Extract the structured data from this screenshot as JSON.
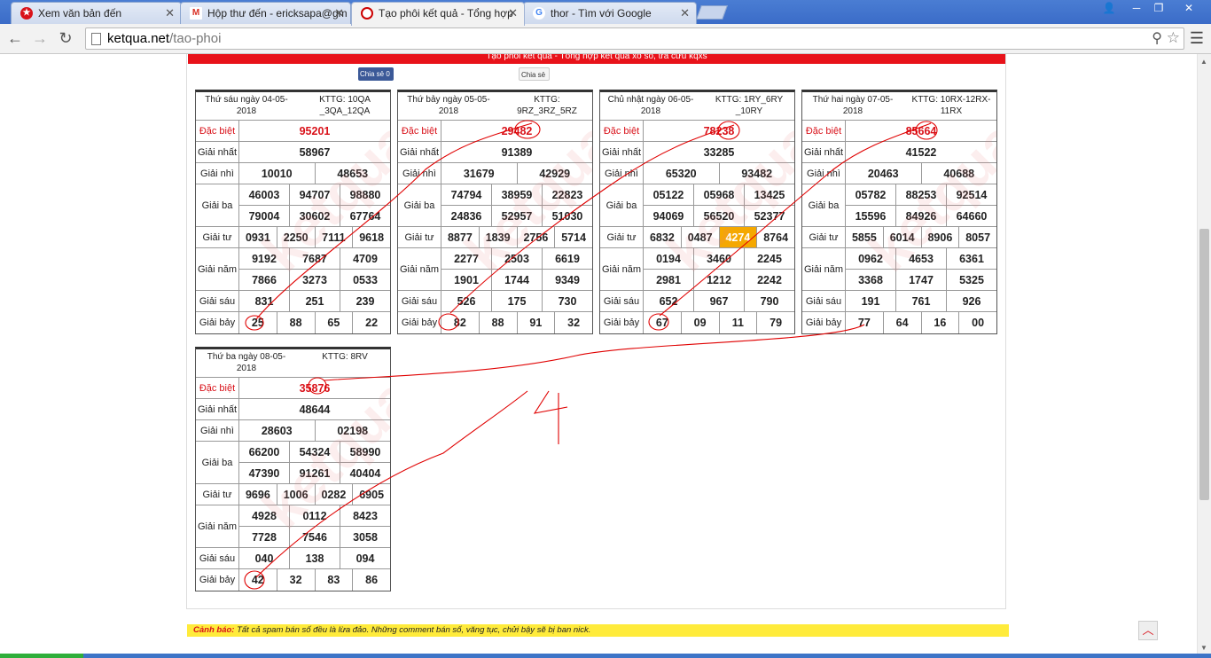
{
  "browser": {
    "tabs": [
      {
        "title": "Xem văn bản đến",
        "favicon": "star-seal-icon",
        "active": false
      },
      {
        "title": "Hộp thư đến - ericksapa@gm",
        "favicon": "gmail-icon",
        "active": false
      },
      {
        "title": "Tạo phôi kết quả - Tổng hợp",
        "favicon": "ketqua-icon",
        "active": true
      },
      {
        "title": "thor - Tìm với Google",
        "favicon": "google-icon",
        "active": false
      }
    ],
    "url_host": "ketqua.net",
    "url_path": "/tao-phoi"
  },
  "page": {
    "banner_text": "Tạo phôi kết quả - Tổng hợp kết quả xổ số, tra cứu kqxs",
    "share_fb": "Chia sẻ 0",
    "share_gplus": "Chia sẻ",
    "watermark": "ketqua.net",
    "warning_label": "Cảnh báo:",
    "warning_text": " Tất cả spam bán số đều là lừa đảo. Những comment bán số, văng tục, chửi bậy sẽ bị ban nick.",
    "annotation_number": "4",
    "colors": {
      "red": "#e8121a",
      "highlight": "#f5a800",
      "ink": "#e00000"
    }
  },
  "labels": {
    "db": "Đặc biệt",
    "g1": "Giải nhất",
    "g2": "Giải nhì",
    "g3": "Giải ba",
    "g4": "Giải tư",
    "g5": "Giải năm",
    "g6": "Giải sáu",
    "g7": "Giải bảy"
  },
  "results": [
    {
      "date": "Thứ sáu ngày 04-05-2018",
      "kttg": "KTTG: 10QA _3QA_12QA",
      "db": "95201",
      "g1": "58967",
      "g2": [
        "10010",
        "48653"
      ],
      "g3": [
        [
          "46003",
          "94707",
          "98880"
        ],
        [
          "79004",
          "30602",
          "67764"
        ]
      ],
      "g4": [
        "0931",
        "2250",
        "7111",
        "9618"
      ],
      "g5": [
        [
          "9192",
          "7687",
          "4709"
        ],
        [
          "7866",
          "3273",
          "0533"
        ]
      ],
      "g6": [
        "831",
        "251",
        "239"
      ],
      "g7": [
        "25",
        "88",
        "65",
        "22"
      ],
      "hl": -1
    },
    {
      "date": "Thứ bảy ngày 05-05-2018",
      "kttg": "KTTG: 9RZ_3RZ_5RZ",
      "db": "29482",
      "g1": "91389",
      "g2": [
        "31679",
        "42929"
      ],
      "g3": [
        [
          "74794",
          "38959",
          "22823"
        ],
        [
          "24836",
          "52957",
          "51030"
        ]
      ],
      "g4": [
        "8877",
        "1839",
        "2756",
        "5714"
      ],
      "g5": [
        [
          "2277",
          "2503",
          "6619"
        ],
        [
          "1901",
          "1744",
          "9349"
        ]
      ],
      "g6": [
        "526",
        "175",
        "730"
      ],
      "g7": [
        "82",
        "88",
        "91",
        "32"
      ],
      "hl": -1
    },
    {
      "date": "Chủ nhật ngày 06-05-2018",
      "kttg": "KTTG: 1RY_6RY _10RY",
      "db": "78238",
      "g1": "33285",
      "g2": [
        "65320",
        "93482"
      ],
      "g3": [
        [
          "05122",
          "05968",
          "13425"
        ],
        [
          "94069",
          "56520",
          "52377"
        ]
      ],
      "g4": [
        "6832",
        "0487",
        "4274",
        "8764"
      ],
      "g5": [
        [
          "0194",
          "3460",
          "2245"
        ],
        [
          "2981",
          "1212",
          "2242"
        ]
      ],
      "g6": [
        "652",
        "967",
        "790"
      ],
      "g7": [
        "67",
        "09",
        "11",
        "79"
      ],
      "hl": 2
    },
    {
      "date": "Thứ hai ngày 07-05-2018",
      "kttg": "KTTG: 10RX-12RX-11RX",
      "db": "85664",
      "g1": "41522",
      "g2": [
        "20463",
        "40688"
      ],
      "g3": [
        [
          "05782",
          "88253",
          "92514"
        ],
        [
          "15596",
          "84926",
          "64660"
        ]
      ],
      "g4": [
        "5855",
        "6014",
        "8906",
        "8057"
      ],
      "g5": [
        [
          "0962",
          "4653",
          "6361"
        ],
        [
          "3368",
          "1747",
          "5325"
        ]
      ],
      "g6": [
        "191",
        "761",
        "926"
      ],
      "g7": [
        "77",
        "64",
        "16",
        "00"
      ],
      "hl": -1
    },
    {
      "date": "Thứ ba ngày 08-05-2018",
      "kttg": "KTTG: 8RV",
      "db": "35876",
      "g1": "48644",
      "g2": [
        "28603",
        "02198"
      ],
      "g3": [
        [
          "66200",
          "54324",
          "58990"
        ],
        [
          "47390",
          "91261",
          "40404"
        ]
      ],
      "g4": [
        "9696",
        "1006",
        "0282",
        "6905"
      ],
      "g5": [
        [
          "4928",
          "0112",
          "8423"
        ],
        [
          "7728",
          "7546",
          "3058"
        ]
      ],
      "g6": [
        "040",
        "138",
        "094"
      ],
      "g7": [
        "42",
        "32",
        "83",
        "86"
      ],
      "hl": -1
    }
  ]
}
